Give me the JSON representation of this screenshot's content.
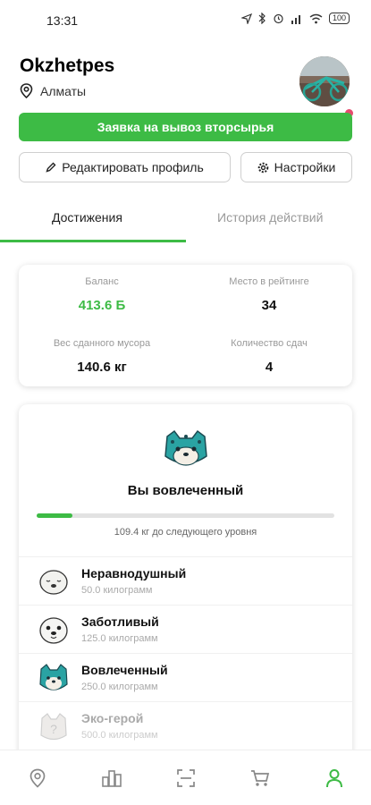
{
  "status_bar": {
    "time": "13:31",
    "battery": "100"
  },
  "profile": {
    "username": "Okzhetpes",
    "city": "Алматы"
  },
  "actions": {
    "request_pickup": "Заявка на вывоз вторсырья",
    "edit_profile": "Редактировать профиль",
    "settings": "Настройки"
  },
  "tabs": [
    {
      "label": "Достижения",
      "active": true
    },
    {
      "label": "История действий",
      "active": false
    }
  ],
  "stats": {
    "balance_label": "Баланс",
    "balance_value": "413.6 Б",
    "rank_label": "Место в рейтинге",
    "rank_value": "34",
    "weight_label": "Вес сданного мусора",
    "weight_value": "140.6 кг",
    "count_label": "Количество сдач",
    "count_value": "4"
  },
  "level": {
    "title": "Вы вовлеченный",
    "progress_fraction": 0.12,
    "progress_text": "109.4 кг до следующего уровня",
    "items": [
      {
        "name": "Неравнодушный",
        "weight": "50.0 килограмм",
        "icon": "seal-sleeping-icon",
        "locked": false
      },
      {
        "name": "Заботливый",
        "weight": "125.0 килограмм",
        "icon": "seal-icon",
        "locked": false
      },
      {
        "name": "Вовлеченный",
        "weight": "250.0 килограмм",
        "icon": "snow-leopard-icon",
        "locked": false
      },
      {
        "name": "Эко-герой",
        "weight": "500.0 килограмм",
        "icon": "locked-badge-icon",
        "locked": true
      }
    ]
  },
  "colors": {
    "accent": "#3dbb45",
    "notification": "#e64b6e"
  },
  "bottom_nav": [
    {
      "icon": "map-pin-icon",
      "active": false
    },
    {
      "icon": "ranking-icon",
      "active": false
    },
    {
      "icon": "scan-icon",
      "active": false
    },
    {
      "icon": "cart-icon",
      "active": false
    },
    {
      "icon": "profile-icon",
      "active": true
    }
  ]
}
